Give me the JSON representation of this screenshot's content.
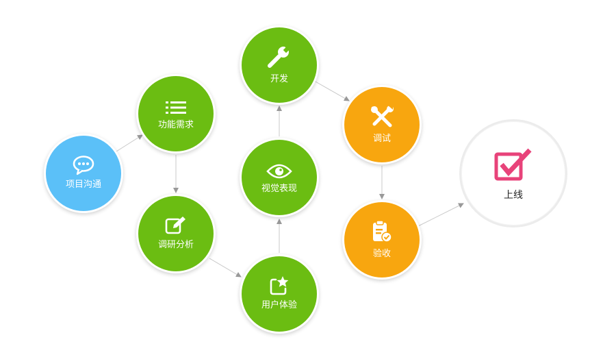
{
  "colors": {
    "blue": "#5bc0f8",
    "green": "#6bbd12",
    "orange": "#f8a60f",
    "check_pink": "#e8437a",
    "arrow": "#999999"
  },
  "nodes": {
    "communication": {
      "label": "项目沟通",
      "icon": "chat-bubble-icon"
    },
    "requirements": {
      "label": "功能需求",
      "icon": "list-icon"
    },
    "research": {
      "label": "调研分析",
      "icon": "edit-icon"
    },
    "ux": {
      "label": "用户体验",
      "icon": "star-frame-icon"
    },
    "visual": {
      "label": "视觉表现",
      "icon": "eye-icon"
    },
    "development": {
      "label": "开发",
      "icon": "wrench-icon"
    },
    "debugging": {
      "label": "调试",
      "icon": "tools-icon"
    },
    "acceptance": {
      "label": "验收",
      "icon": "clipboard-check-icon"
    },
    "launch": {
      "label": "上线",
      "icon": "checkbox-check-icon"
    }
  }
}
